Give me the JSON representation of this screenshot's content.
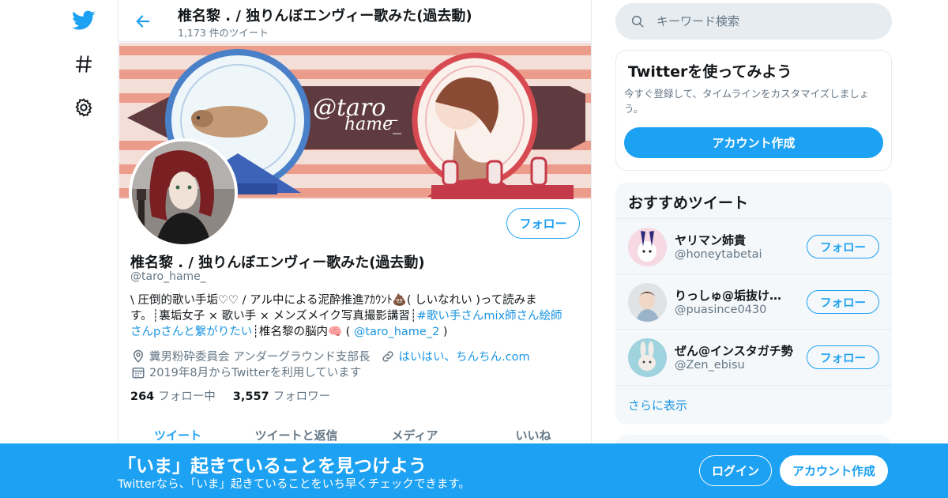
{
  "header": {
    "title": "椎名黎 . / 独りんぼエンヴィー歌みた(過去動)",
    "tweet_count": "1,173 件のツイート"
  },
  "banner": {
    "text": "@taro_ hame_"
  },
  "profile": {
    "name": "椎名黎 . / 独りんぼエンヴィー歌みた(過去動)",
    "handle": "@taro_hame_",
    "follow_label": "フォロー",
    "bio_line1": "\\ 圧倒的歌い手垢♡♡ / アル中による泥酔推進ｱｶｳﾝﾄ💩( しいなれい )って読みま",
    "bio_line2a": "す。┊裏垢女子 × 歌い手 × メンズメイク写真撮影講習┊",
    "bio_hashtag_a": "#歌い手さんmix師さん絵師",
    "bio_hashtag_b": "さんpさんと繋がりたい",
    "bio_line3b": "┊椎名黎の脳内🧠 ( ",
    "bio_mention": "@taro_hame_2",
    "bio_line3c": " )",
    "location": "糞男粉砕委員会 アンダーグラウンド支部長",
    "website": "はいはい、ちんちん.com",
    "joined": "2019年8月からTwitterを利用しています",
    "following_count": "264",
    "following_label": "フォロー中",
    "followers_count": "3,557",
    "followers_label": "フォロワー"
  },
  "tabs": [
    {
      "label": "ツイート",
      "active": true
    },
    {
      "label": "ツイートと返信",
      "active": false
    },
    {
      "label": "メディア",
      "active": false
    },
    {
      "label": "いいね",
      "active": false
    }
  ],
  "search": {
    "placeholder": "キーワード検索"
  },
  "try_twitter": {
    "title": "Twitterを使ってみよう",
    "description": "今すぐ登録して、タイムラインをカスタマイズしましょう。",
    "button": "アカウント作成"
  },
  "recommended": {
    "title": "おすすめツイート",
    "items": [
      {
        "name": "ヤリマン姉貴",
        "handle": "@honeytabetai",
        "follow": "フォロー"
      },
      {
        "name": "りっしゅ@垢抜けサロン",
        "handle": "@puasince0430",
        "follow": "フォロー"
      },
      {
        "name": "ぜん@インスタガチ勢",
        "handle": "@Zen_ebisu",
        "follow": "フォロー"
      }
    ],
    "more": "さらに表示"
  },
  "bottom_bar": {
    "title": "「いま」起きていることを見つけよう",
    "subtitle": "Twitterなら、「いま」起きていることをいち早くチェックできます。",
    "login": "ログイン",
    "signup": "アカウント作成"
  },
  "colors": {
    "accent": "#1da1f2",
    "link": "#1b95e0",
    "secondary_text": "#657786",
    "border": "#e6ecf0"
  },
  "icons": [
    "twitter-bird-icon",
    "hashtag-icon",
    "gear-icon",
    "back-arrow-icon",
    "search-icon",
    "location-icon",
    "link-icon",
    "calendar-icon"
  ]
}
